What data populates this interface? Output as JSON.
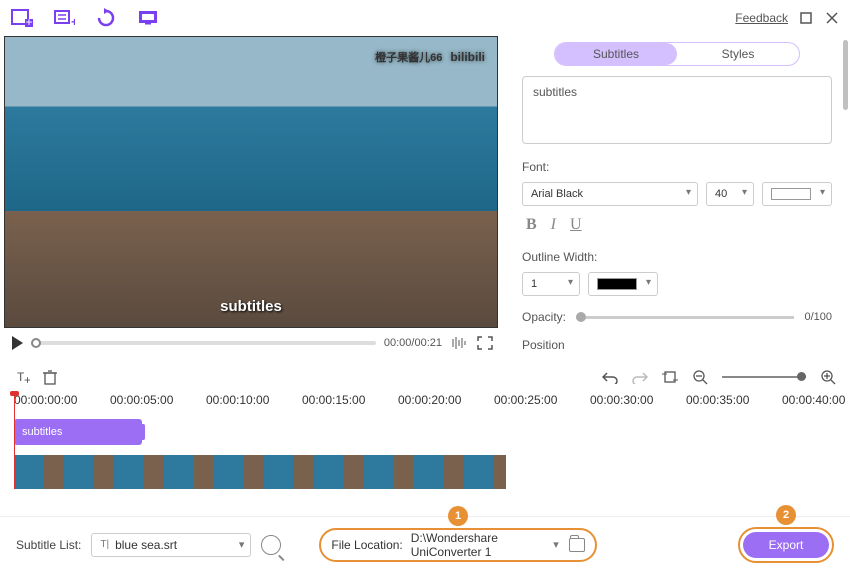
{
  "header": {
    "feedback": "Feedback"
  },
  "video": {
    "watermark_cn": "橙子果酱儿66",
    "watermark": "bilibili",
    "subtitle_overlay": "subtitles"
  },
  "player": {
    "time": "00:00/00:21"
  },
  "tabs": {
    "subtitles": "Subtitles",
    "styles": "Styles"
  },
  "panel": {
    "text_value": "subtitles",
    "font_label": "Font:",
    "font_name": "Arial Black",
    "font_size": "40",
    "outline_label": "Outline Width:",
    "outline_width": "1",
    "opacity_label": "Opacity:",
    "opacity_value": "0/100",
    "position_label": "Position"
  },
  "timeline": {
    "ticks": [
      "00:00:00:00",
      "00:00:05:00",
      "00:00:10:00",
      "00:00:15:00",
      "00:00:20:00",
      "00:00:25:00",
      "00:00:30:00",
      "00:00:35:00",
      "00:00:40:00"
    ],
    "clip_label": "subtitles"
  },
  "bottom": {
    "subtitle_list_label": "Subtitle List:",
    "subtitle_file": "blue sea.srt",
    "file_location_label": "File Location:",
    "file_location_value": "D:\\Wondershare UniConverter 1",
    "export": "Export",
    "callout1": "1",
    "callout2": "2"
  }
}
